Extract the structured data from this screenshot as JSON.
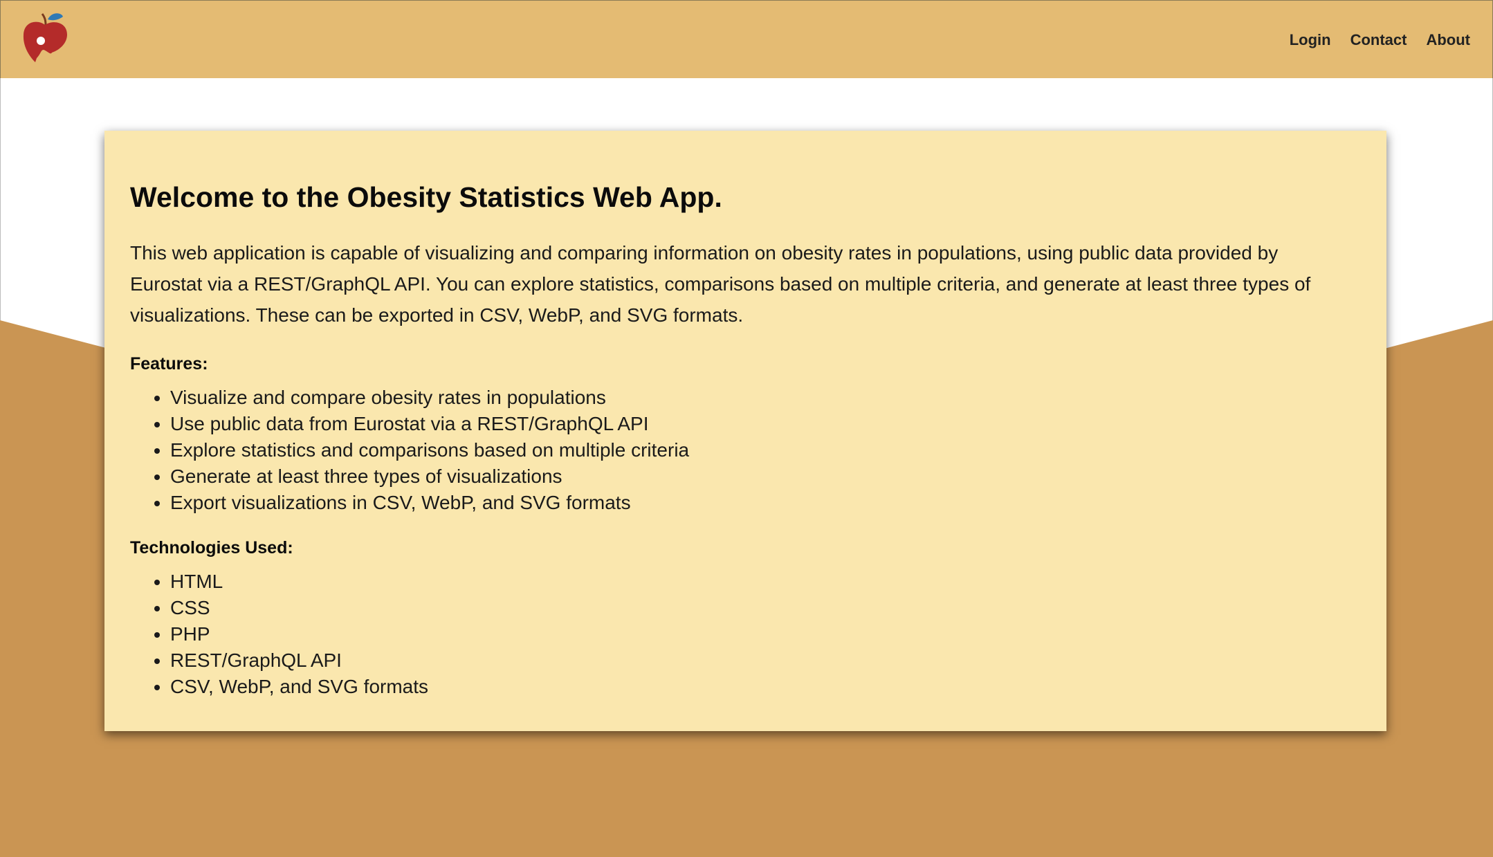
{
  "theme": {
    "header_bg": "#e4bb73",
    "card_bg": "#fae7ae",
    "wave_bg": "#ca9553",
    "page_bg": "#ffffff",
    "logo_apple": "#b42b2a",
    "logo_leaf": "#2f79b5"
  },
  "header": {
    "logo_icon": "apple-person-logo",
    "nav": [
      {
        "label": "Login"
      },
      {
        "label": "Contact"
      },
      {
        "label": "About"
      }
    ]
  },
  "main": {
    "title": "Welcome to the Obesity Statistics Web App.",
    "intro_line_1": "This web application is capable of visualizing and comparing information on obesity rates in populations, using public data provided by",
    "intro_line_2": "Eurostat via a REST/GraphQL API. You can explore statistics, comparisons based on multiple criteria, and generate at least three types of",
    "intro_line_3": "visualizations. These can be exported in CSV, WebP, and SVG formats.",
    "features_heading": "Features:",
    "features": [
      "Visualize and compare obesity rates in populations",
      "Use public data from Eurostat via a REST/GraphQL API",
      "Explore statistics and comparisons based on multiple criteria",
      "Generate at least three types of visualizations",
      "Export visualizations in CSV, WebP, and SVG formats"
    ],
    "tech_heading": "Technologies Used:",
    "technologies": [
      "HTML",
      "CSS",
      "PHP",
      "REST/GraphQL API",
      "CSV, WebP, and SVG formats"
    ]
  }
}
